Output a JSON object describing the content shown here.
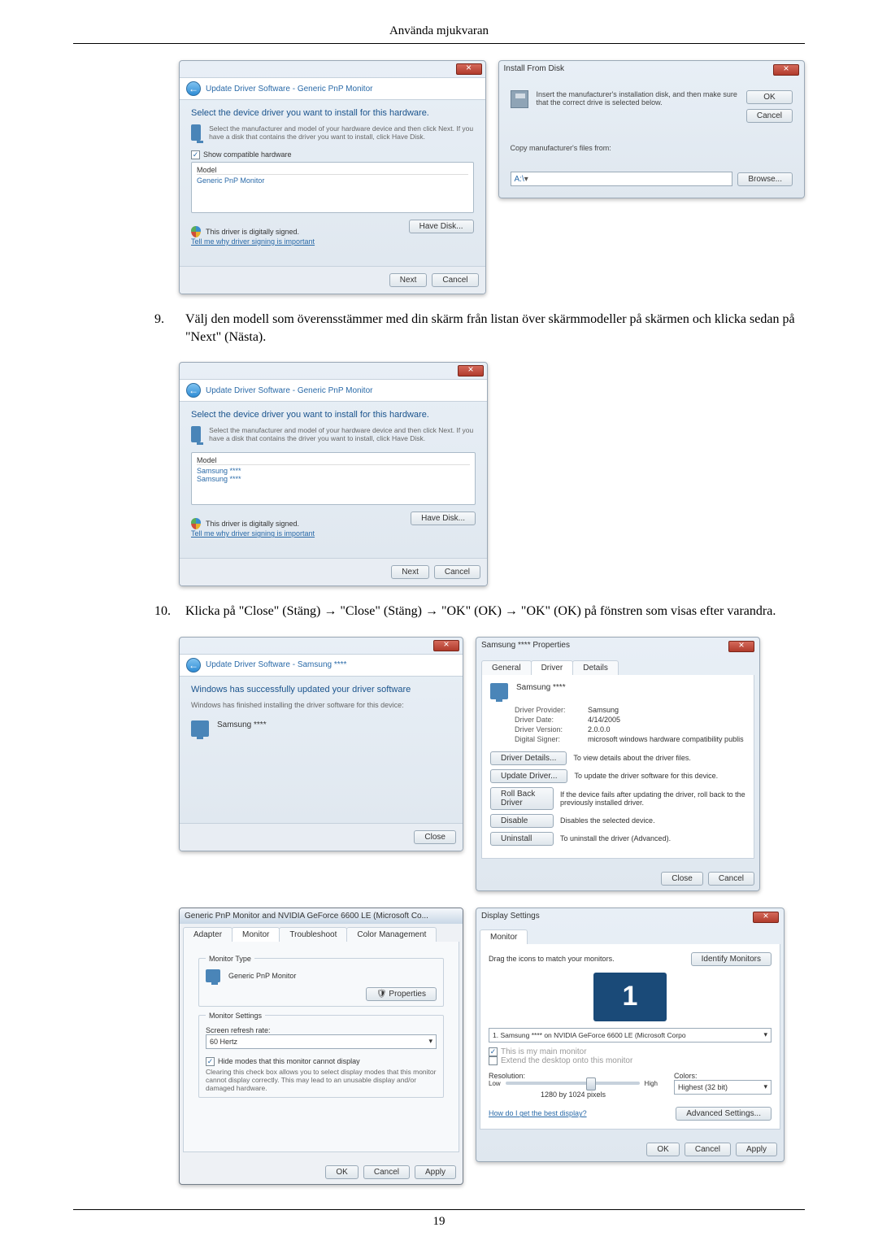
{
  "header": {
    "title": "Använda mjukvaran"
  },
  "steps": {
    "nine": {
      "num": "9.",
      "text": "Välj den modell som överensstämmer med din skärm från listan över skärmmodeller på skärmen och klicka sedan på \"Next\" (Nästa)."
    },
    "ten": {
      "num": "10.",
      "text": "Klicka på \"Close\" (Stäng) → \"Close\" (Stäng) → \"OK\" (OK) → \"OK\" (OK) på fönstren som visas efter varandra."
    }
  },
  "updateDriver1": {
    "crumb": "Update Driver Software - Generic PnP Monitor",
    "heading": "Select the device driver you want to install for this hardware.",
    "subtext": "Select the manufacturer and model of your hardware device and then click Next. If you have a disk that contains the driver you want to install, click Have Disk.",
    "showCompat": "Show compatible hardware",
    "modelHdr": "Model",
    "model1": "Generic PnP Monitor",
    "signed": "This driver is digitally signed.",
    "tellWhy": "Tell me why driver signing is important",
    "haveDisk": "Have Disk...",
    "next": "Next",
    "cancel": "Cancel"
  },
  "installFromDisk": {
    "title": "Install From Disk",
    "text": "Insert the manufacturer's installation disk, and then make sure that the correct drive is selected below.",
    "ok": "OK",
    "cancel": "Cancel",
    "copyLabel": "Copy manufacturer's files from:",
    "driveValue": "A:\\",
    "browse": "Browse..."
  },
  "updateDriver2": {
    "crumb": "Update Driver Software - Generic PnP Monitor",
    "heading": "Select the device driver you want to install for this hardware.",
    "subtext": "Select the manufacturer and model of your hardware device and then click Next. If you have a disk that contains the driver you want to install, click Have Disk.",
    "modelHdr": "Model",
    "m1": "Samsung ****",
    "m2": "Samsung ****",
    "signed": "This driver is digitally signed.",
    "tellWhy": "Tell me why driver signing is important",
    "haveDisk": "Have Disk...",
    "next": "Next",
    "cancel": "Cancel"
  },
  "updateDriver3": {
    "crumb": "Update Driver Software - Samsung ****",
    "heading": "Windows has successfully updated your driver software",
    "subtext": "Windows has finished installing the driver software for this device:",
    "device": "Samsung ****",
    "close": "Close"
  },
  "propsDialog": {
    "title": "Samsung **** Properties",
    "tabs": {
      "general": "General",
      "driver": "Driver",
      "details": "Details"
    },
    "device": "Samsung ****",
    "k": {
      "provider": "Driver Provider:",
      "date": "Driver Date:",
      "version": "Driver Version:",
      "signer": "Digital Signer:"
    },
    "v": {
      "provider": "Samsung",
      "date": "4/14/2005",
      "version": "2.0.0.0",
      "signer": "microsoft windows hardware compatibility publis"
    },
    "btns": {
      "details": "Driver Details...",
      "detailsTxt": "To view details about the driver files.",
      "update": "Update Driver...",
      "updateTxt": "To update the driver software for this device.",
      "rollback": "Roll Back Driver",
      "rollbackTxt": "If the device fails after updating the driver, roll back to the previously installed driver.",
      "disable": "Disable",
      "disableTxt": "Disables the selected device.",
      "uninstall": "Uninstall",
      "uninstallTxt": "To uninstall the driver (Advanced)."
    },
    "close": "Close",
    "cancel": "Cancel"
  },
  "monitorProps": {
    "title": "Generic PnP Monitor and NVIDIA GeForce 6600 LE (Microsoft Co...",
    "tabs": {
      "adapter": "Adapter",
      "monitor": "Monitor",
      "troubleshoot": "Troubleshoot",
      "colorMgmt": "Color Management"
    },
    "monitorType": "Monitor Type",
    "monitorName": "Generic PnP Monitor",
    "propsBtn": "Properties",
    "monitorSettings": "Monitor Settings",
    "refreshLbl": "Screen refresh rate:",
    "refreshVal": "60 Hertz",
    "hideModes": "Hide modes that this monitor cannot display",
    "hideDesc": "Clearing this check box allows you to select display modes that this monitor cannot display correctly. This may lead to an unusable display and/or damaged hardware.",
    "ok": "OK",
    "cancel": "Cancel",
    "apply": "Apply"
  },
  "displaySettings": {
    "title": "Display Settings",
    "tab": "Monitor",
    "drag": "Drag the icons to match your monitors.",
    "identify": "Identify Monitors",
    "monNum": "1",
    "dropdown": "1. Samsung **** on NVIDIA GeForce 6600 LE (Microsoft Corpo",
    "isMain": "This is my main monitor",
    "extend": "Extend the desktop onto this monitor",
    "resolution": "Resolution:",
    "low": "Low",
    "high": "High",
    "resVal": "1280 by 1024 pixels",
    "colors": "Colors:",
    "colorsVal": "Highest (32 bit)",
    "bestDisp": "How do I get the best display?",
    "advanced": "Advanced Settings...",
    "ok": "OK",
    "cancel": "Cancel",
    "apply": "Apply"
  },
  "footer": {
    "page": "19"
  }
}
